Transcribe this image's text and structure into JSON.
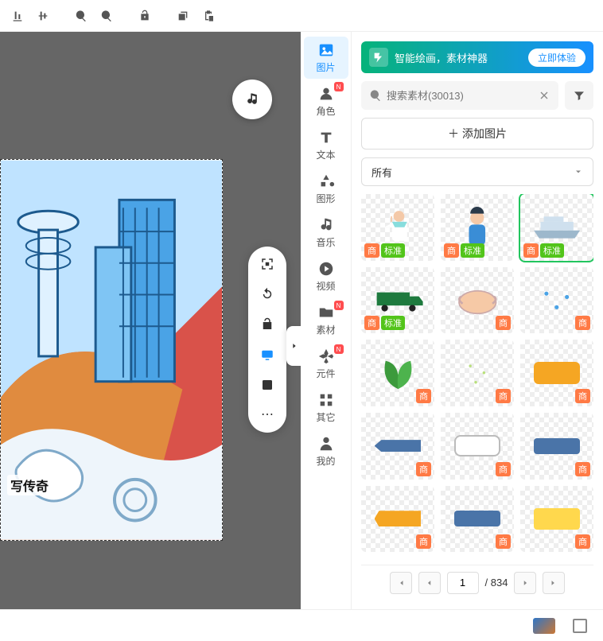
{
  "canvas": {
    "caption": "写传奇"
  },
  "categories": [
    {
      "label": "图片",
      "icon": "image",
      "active": true
    },
    {
      "label": "角色",
      "icon": "user",
      "badge": "N"
    },
    {
      "label": "文本",
      "icon": "text"
    },
    {
      "label": "图形",
      "icon": "shapes"
    },
    {
      "label": "音乐",
      "icon": "music"
    },
    {
      "label": "视频",
      "icon": "video"
    },
    {
      "label": "素材",
      "icon": "folder",
      "badge": "N"
    },
    {
      "label": "元件",
      "icon": "component",
      "badge": "N"
    },
    {
      "label": "其它",
      "icon": "grid"
    },
    {
      "label": "我的",
      "icon": "person"
    }
  ],
  "promo": {
    "text": "智能绘画，素材神器",
    "button": "立即体验"
  },
  "search": {
    "placeholder": "搜索素材(30013)"
  },
  "addButton": "添加图片",
  "dropdown": {
    "value": "所有"
  },
  "assets": [
    {
      "type": "doctor",
      "tags": [
        "商",
        "标准"
      ]
    },
    {
      "type": "person",
      "tags": [
        "商",
        "标准"
      ]
    },
    {
      "type": "ship",
      "tags": [
        "商",
        "标准"
      ],
      "selected": true
    },
    {
      "type": "truck",
      "tags": [
        "商",
        "标准"
      ]
    },
    {
      "type": "chicken",
      "tags_br": "商"
    },
    {
      "type": "dots",
      "tags_br": "商"
    },
    {
      "type": "leaves",
      "tags_br": "商"
    },
    {
      "type": "sparkle",
      "tags_br": "商"
    },
    {
      "type": "rect-y",
      "tags_br": "商"
    },
    {
      "type": "arrow-b",
      "tags_br": "商"
    },
    {
      "type": "speech",
      "tags_br": "商"
    },
    {
      "type": "rect-b",
      "tags_br": "商"
    },
    {
      "type": "rect-o",
      "tags_br": "商"
    },
    {
      "type": "rect-b",
      "tags_br": "商"
    },
    {
      "type": "rect-y2",
      "tags_br": "商"
    }
  ],
  "pagination": {
    "current": "1",
    "total": "/ 834"
  }
}
